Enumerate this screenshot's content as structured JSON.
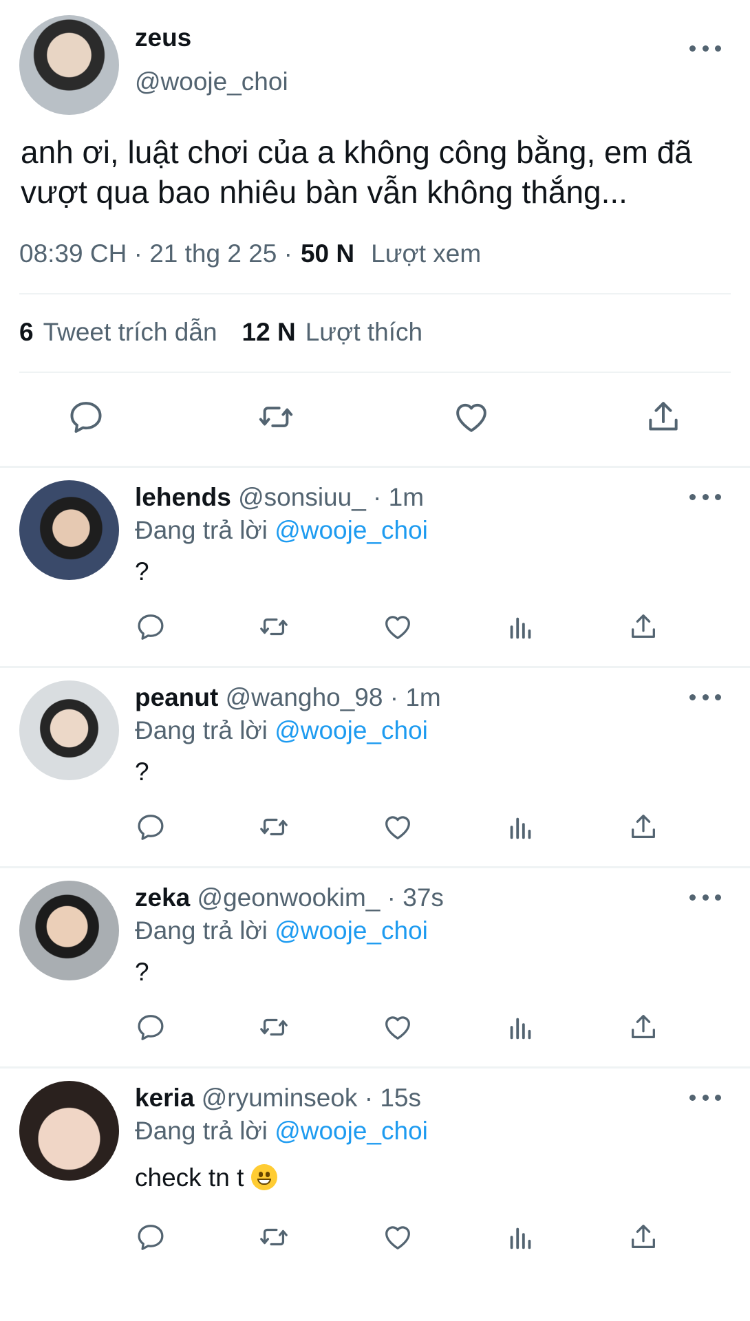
{
  "main_tweet": {
    "name": "zeus",
    "handle": "@wooje_choi",
    "text": "anh ơi, luật chơi của a không công bằng, em đã vượt qua bao nhiêu bàn vẫn không thắng...",
    "time": "08:39 CH · 21 thg 2 25 ·",
    "views_count": "50 N",
    "views_label": "Lượt xem",
    "quotes_count": "6",
    "quotes_label": "Tweet trích dẫn",
    "likes_count": "12 N",
    "likes_label": "Lượt thích"
  },
  "replies": [
    {
      "name": "lehends",
      "meta": "@sonsiuu_ · 1m",
      "replying_label": "Đang trả lời",
      "mention": "@wooje_choi",
      "text": "?"
    },
    {
      "name": "peanut",
      "meta": "@wangho_98 · 1m",
      "replying_label": "Đang trả lời",
      "mention": "@wooje_choi",
      "text": "?"
    },
    {
      "name": "zeka",
      "meta": "@geonwookim_ · 37s",
      "replying_label": "Đang trả lời",
      "mention": "@wooje_choi",
      "text": "?"
    },
    {
      "name": "keria",
      "meta": "@ryuminseok · 15s",
      "replying_label": "Đang trả lời",
      "mention": "@wooje_choi",
      "text": "check tn t"
    }
  ],
  "icons": [
    "more-icon",
    "reply-icon",
    "retweet-icon",
    "like-icon",
    "share-icon",
    "views-icon"
  ],
  "colors": {
    "text": "#0f1419",
    "secondary": "#536471",
    "mention": "#1d9bf0",
    "divider": "#eff3f4"
  }
}
